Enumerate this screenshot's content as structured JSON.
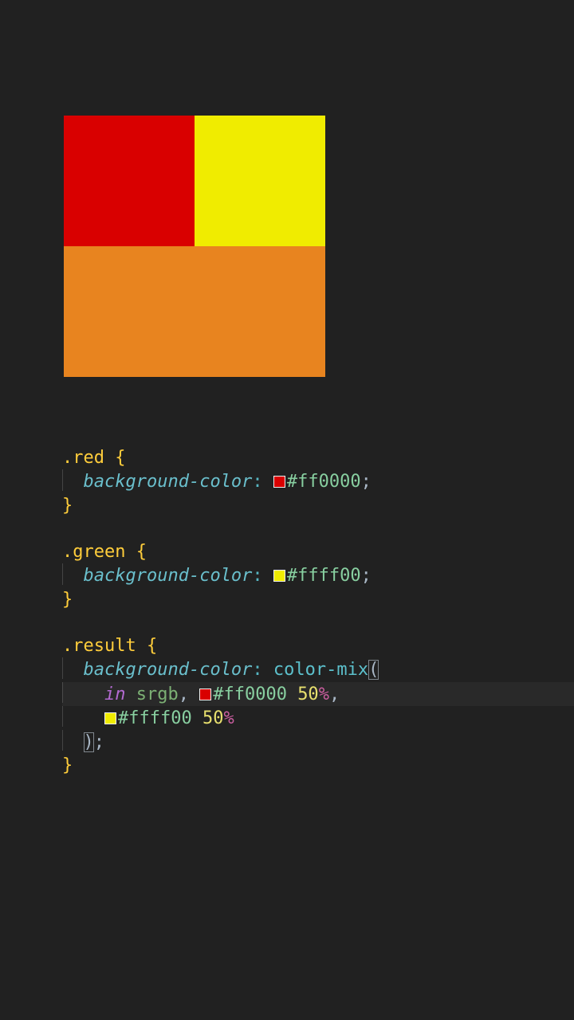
{
  "preview": {
    "red_color": "#d90000",
    "yellow_color": "#f0ec00",
    "result_color": "#e8841f"
  },
  "code": {
    "rule1": {
      "selector": ".red",
      "lbrace": "{",
      "prop": "background-color",
      "colon": ":",
      "swatch_color": "#d90000",
      "hex": "#ff0000",
      "semicolon": ";",
      "rbrace": "}"
    },
    "rule2": {
      "selector": ".green",
      "lbrace": "{",
      "prop": "background-color",
      "colon": ":",
      "swatch_color": "#f0ec00",
      "hex": "#ffff00",
      "semicolon": ";",
      "rbrace": "}"
    },
    "rule3": {
      "selector": ".result",
      "lbrace": "{",
      "prop": "background-color",
      "colon": ":",
      "func": "color-mix",
      "lparen": "(",
      "in_kw": "in",
      "space1": " ",
      "colorspace": "srgb",
      "comma1": ",",
      "swatch1_color": "#d90000",
      "hex1": "#ff0000",
      "num1": "50",
      "pct1": "%",
      "comma2": ",",
      "swatch2_color": "#f0ec00",
      "hex2": "#ffff00",
      "num2": "50",
      "pct2": "%",
      "rparen": ")",
      "semicolon": ";",
      "rbrace": "}"
    }
  }
}
